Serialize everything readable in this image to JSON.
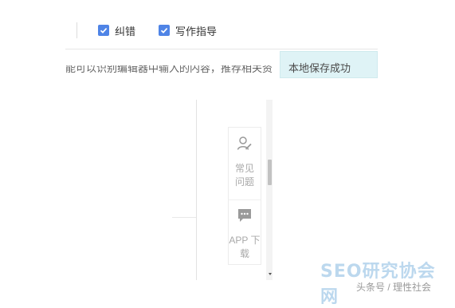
{
  "toolbar": {
    "checkboxes": [
      {
        "label": "纠错",
        "checked": true
      },
      {
        "label": "写作指导",
        "checked": true
      }
    ]
  },
  "editor": {
    "hint_text": "能可以识别编辑器中输入的内容，推荐相关资"
  },
  "toast": {
    "message": "本地保存成功"
  },
  "side_panel": {
    "faq_label": "常见问题",
    "faq_icon": "user-edit-icon",
    "app_label": "APP 下载",
    "app_icon": "chat-bubble-icon"
  },
  "watermark": {
    "logo_text": "SEO研究协会网",
    "caption": "头条号 / 理性社会"
  },
  "colors": {
    "accent": "#4f84e6",
    "toast_bg": "#dff3f6",
    "watermark": "#bcd8ee"
  }
}
